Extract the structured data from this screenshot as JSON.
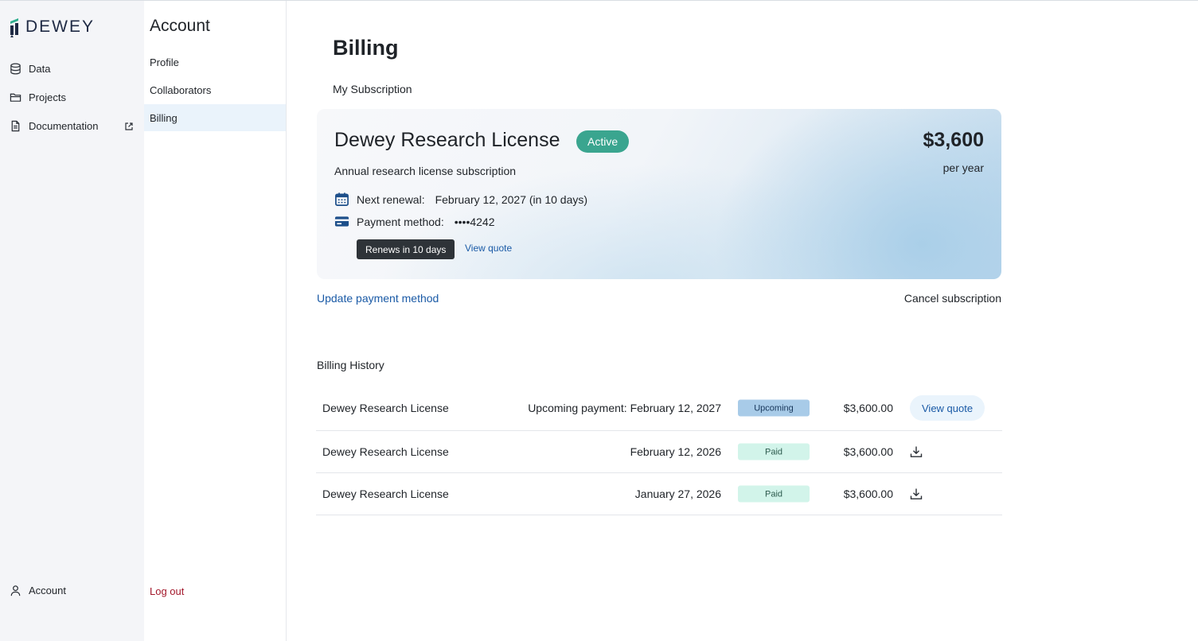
{
  "brand": {
    "name": "DEWEY",
    "accent": "#2fae8e",
    "navy": "#1f2a44"
  },
  "sidebar": {
    "items": [
      {
        "label": "Data",
        "icon": "database-icon"
      },
      {
        "label": "Projects",
        "icon": "folder-icon"
      },
      {
        "label": "Documentation",
        "icon": "document-icon",
        "external": "external-link-icon"
      }
    ],
    "account_label": "Account"
  },
  "subnav": {
    "title": "Account",
    "items": [
      {
        "label": "Profile"
      },
      {
        "label": "Collaborators"
      },
      {
        "label": "Billing",
        "active": true
      }
    ],
    "logout": "Log out"
  },
  "main": {
    "title": "Billing",
    "subscription_heading": "My Subscription",
    "subscription": {
      "name": "Dewey Research License",
      "status": "Active",
      "description": "Annual research license subscription",
      "renewal_label": "Next renewal:",
      "renewal_value": "February 12, 2027 (in 10 days)",
      "payment_label": "Payment method:",
      "payment_value": "••••4242",
      "renews_chip": "Renews in 10 days",
      "view_quote": "View quote",
      "price": "$3,600",
      "period": "per year"
    },
    "update_payment": "Update payment method",
    "cancel_subscription": "Cancel subscription",
    "history_heading": "Billing History",
    "history": [
      {
        "name": "Dewey Research License",
        "date": "Upcoming payment: February 12, 2027",
        "status": "Upcoming",
        "amount": "$3,600.00",
        "action": "View quote"
      },
      {
        "name": "Dewey Research License",
        "date": "February 12, 2026",
        "status": "Paid",
        "amount": "$3,600.00",
        "action": "download-icon"
      },
      {
        "name": "Dewey Research License",
        "date": "January 27, 2026",
        "status": "Paid",
        "amount": "$3,600.00",
        "action": "download-icon"
      }
    ]
  },
  "colors": {
    "active_badge": "#3aa58f",
    "link": "#1a5aa6",
    "logout": "#a3182b",
    "status_upcoming": "#a8cbe8",
    "status_paid": "#d2f4ea"
  }
}
